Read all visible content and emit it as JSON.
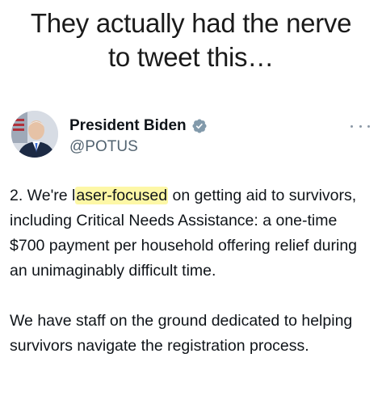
{
  "caption": {
    "line1": "They actually had the nerve",
    "line2": "to tweet this…"
  },
  "tweet": {
    "author": {
      "display_name": "President Biden",
      "handle": "@POTUS",
      "verified": true,
      "avatar_icon": "profile-photo"
    },
    "more_icon": "more-horizontal-icon",
    "paragraph1": {
      "before": "2. We're l",
      "highlighted": "aser-focused",
      "after": " on getting aid to survivors, including Critical Needs Assistance: a one-time $700 payment per household offering relief during an unimaginably difficult time."
    },
    "paragraph2": "We have staff on the ground dedicated to helping survivors navigate the registration process."
  },
  "colors": {
    "highlight": "#fdf7a6",
    "verified_badge": "#829aab",
    "handle": "#536471"
  }
}
